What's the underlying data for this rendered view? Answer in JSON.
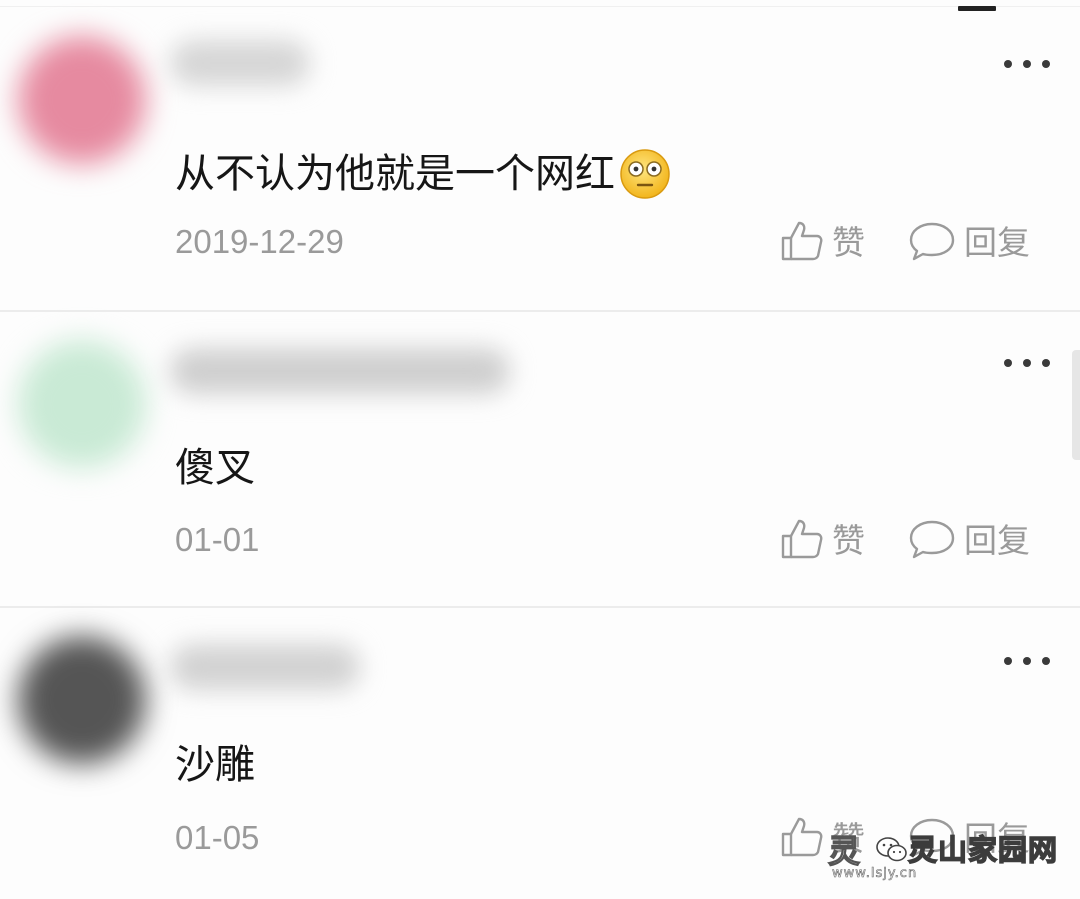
{
  "comments": [
    {
      "text": "从不认为他就是一个网红",
      "emoji": "dizzy-face-emoji",
      "date": "2019-12-29",
      "like_label": "赞",
      "reply_label": "回复",
      "avatar_color": "#e68aa0"
    },
    {
      "text": "傻叉",
      "date": "01-01",
      "like_label": "赞",
      "reply_label": "回复",
      "avatar_color": "#bfe3cc"
    },
    {
      "text": "沙雕",
      "date": "01-05",
      "like_label": "赞",
      "reply_label": "回复",
      "avatar_color": "#4a4a4a"
    }
  ],
  "watermark": {
    "text": "灵山家园网",
    "url": "www.lsjy.cn"
  },
  "colors": {
    "text": "#161616",
    "meta": "#9a9a9a",
    "divider": "#ececec"
  },
  "icons": [
    "more-icon",
    "thumbs-up-icon",
    "comment-bubble-icon",
    "wechat-logo-icon"
  ]
}
